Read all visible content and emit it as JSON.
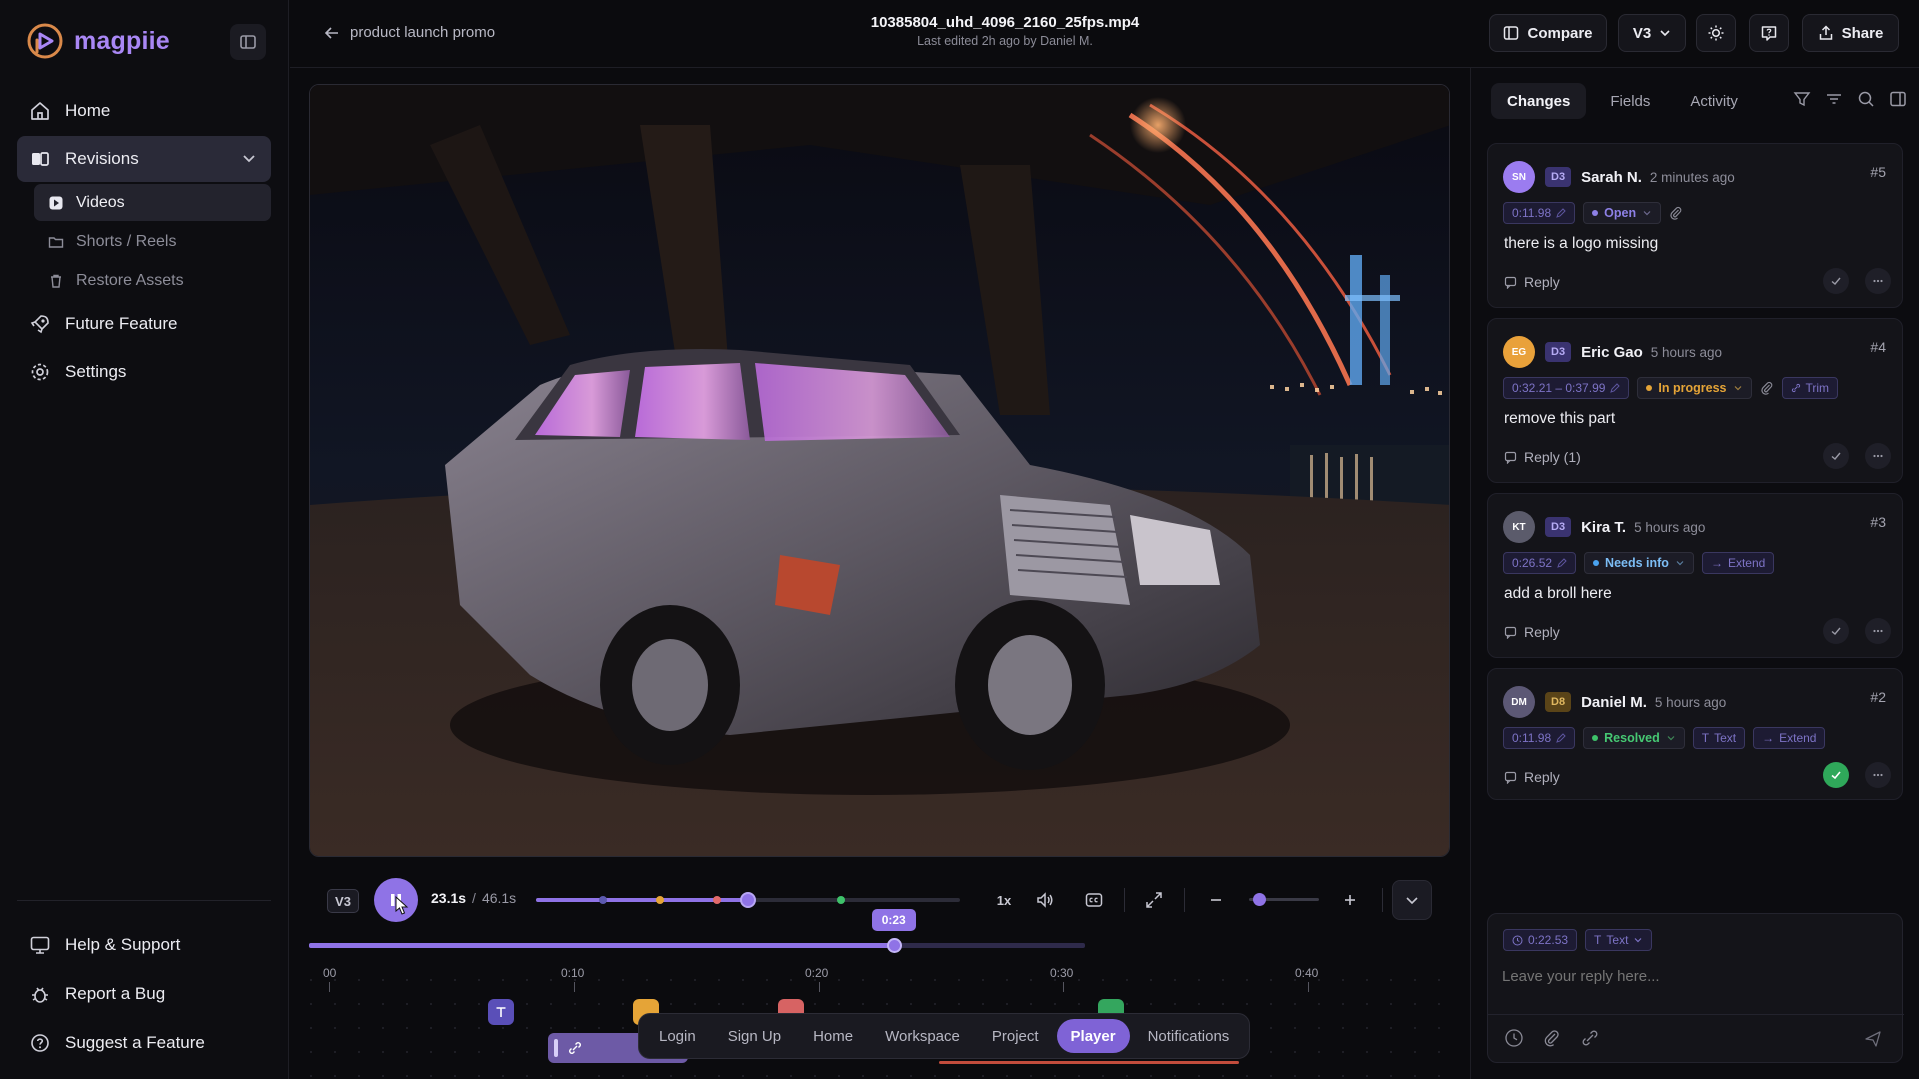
{
  "app": {
    "name": "magpiie"
  },
  "sidebar": {
    "items": [
      {
        "label": "Home"
      },
      {
        "label": "Revisions"
      },
      {
        "label": "Future Feature"
      },
      {
        "label": "Settings"
      }
    ],
    "sub_items": [
      {
        "label": "Videos"
      },
      {
        "label": "Shorts / Reels"
      },
      {
        "label": "Restore Assets"
      }
    ],
    "bottom_items": [
      {
        "label": "Help & Support"
      },
      {
        "label": "Report a Bug"
      },
      {
        "label": "Suggest a Feature"
      }
    ]
  },
  "header": {
    "back_label": "product launch promo",
    "file_title": "10385804_uhd_4096_2160_25fps.mp4",
    "file_subtitle": "Last edited 2h ago by Daniel M.",
    "compare_label": "Compare",
    "version_label": "V3",
    "share_label": "Share"
  },
  "player": {
    "version_pill": "V3",
    "current_time": "23.1s",
    "separator": "/",
    "duration": "46.1s",
    "progress_fraction": 0.5,
    "speed": "1x",
    "playhead_label": "0:23",
    "ticks": [
      "00",
      "0:10",
      "0:20",
      "0:30",
      "0:40"
    ]
  },
  "bottom_nav": {
    "items": [
      "Login",
      "Sign Up",
      "Home",
      "Workspace",
      "Project",
      "Player",
      "Notifications"
    ],
    "active": "Player"
  },
  "panel": {
    "tabs": [
      {
        "label": "Changes"
      },
      {
        "label": "Fields"
      },
      {
        "label": "Activity"
      }
    ],
    "comments": [
      {
        "initials": "SN",
        "avatar_color": "#9b7cf0",
        "badge": "D3",
        "badge_color": "#6c5cd6",
        "author": "Sarah N.",
        "time_ago": "2 minutes ago",
        "number": "#5",
        "timecode": "0:11.98",
        "status": "Open",
        "status_color": "#8d80e6",
        "tags": [],
        "text": "there is a logo missing",
        "reply_label": "Reply",
        "resolved": false
      },
      {
        "initials": "EG",
        "avatar_color": "#e9a13a",
        "badge": "D3",
        "badge_color": "#6c5cd6",
        "author": "Eric Gao",
        "time_ago": "5 hours ago",
        "number": "#4",
        "timecode": "0:32.21 – 0:37.99",
        "status": "In progress",
        "status_color": "#e5a437",
        "tags": [
          "Trim"
        ],
        "text": "remove this part",
        "reply_label": "Reply (1)",
        "resolved": false
      },
      {
        "initials": "KT",
        "avatar_color": "#5b5b6b",
        "badge": "D3",
        "badge_color": "#6c5cd6",
        "author": "Kira T.",
        "time_ago": "5 hours ago",
        "number": "#3",
        "timecode": "0:26.52",
        "status": "Needs info",
        "status_color": "#4aa3f0",
        "tags": [
          "Extend"
        ],
        "text": "add a broll here",
        "reply_label": "Reply",
        "resolved": false
      },
      {
        "initials": "DM",
        "avatar_color": "#5c5875",
        "badge": "D8",
        "badge_color": "#b58a2a",
        "author": "Daniel M.",
        "time_ago": "5 hours ago",
        "number": "#2",
        "timecode": "0:11.98",
        "status": "Resolved",
        "status_color": "#3ec26a",
        "tags": [
          "Text",
          "Extend"
        ],
        "text": "",
        "reply_label": "Reply",
        "resolved": true
      }
    ],
    "reply_box": {
      "timecode": "0:22.53",
      "type_label": "Text",
      "placeholder": "Leave your reply here..."
    }
  },
  "colors": {
    "accent": "#8f73e6",
    "bg": "#0b0b0e"
  }
}
